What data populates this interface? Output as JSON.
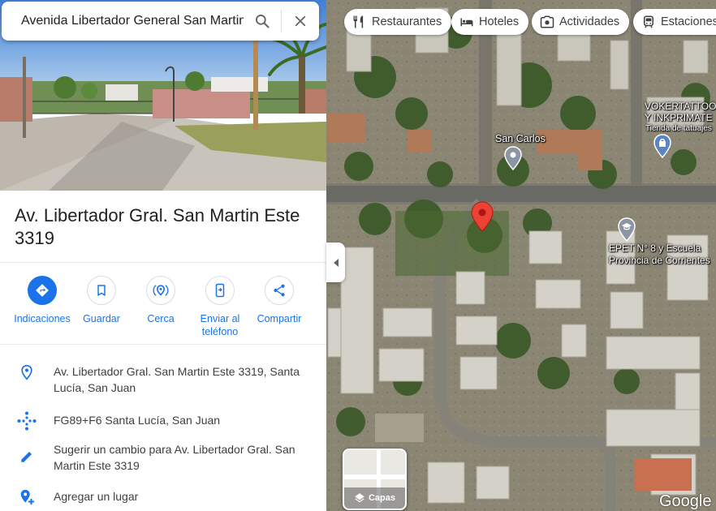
{
  "search": {
    "query": "Avenida Libertador General San Martin",
    "search_icon": "search-icon",
    "close_icon": "close-icon"
  },
  "place": {
    "title": "Av. Libertador Gral. San Martin Este 3319"
  },
  "actions": [
    {
      "label": "Indicaciones",
      "icon": "directions-icon"
    },
    {
      "label": "Guardar",
      "icon": "bookmark-icon"
    },
    {
      "label": "Cerca",
      "icon": "nearby-icon"
    },
    {
      "label": "Enviar al teléfono",
      "icon": "send-to-phone-icon"
    },
    {
      "label": "Compartir",
      "icon": "share-icon"
    }
  ],
  "info": {
    "address": "Av. Libertador Gral. San Martin Este 3319, Santa Lucía, San Juan",
    "plus_code": "FG89+F6 Santa Lucía, San Juan",
    "suggest_edit": "Sugerir un cambio para Av. Libertador Gral. San Martin Este 3319",
    "add_place": "Agregar un lugar"
  },
  "chips": [
    {
      "label": "Restaurantes",
      "icon": "restaurant-icon"
    },
    {
      "label": "Hoteles",
      "icon": "hotel-icon"
    },
    {
      "label": "Actividades",
      "icon": "camera-icon"
    },
    {
      "label": "Estaciones",
      "icon": "transit-icon"
    }
  ],
  "map_labels": {
    "san_carlos": "San Carlos",
    "vokertattoo_1": "VOKERTATTOO",
    "vokertattoo_2": "Y INKPRIMATE",
    "vokertattoo_sub": "Tienda de tatuajes",
    "epet_1": "EPET N° 8 y Escuela",
    "epet_2": "Provincia de Corrientes"
  },
  "layers": {
    "label": "Capas"
  },
  "branding": {
    "logo": "Google"
  },
  "colors": {
    "accent": "#1a73e8",
    "pin": "#ea4335",
    "poi": "#5b84c4"
  }
}
